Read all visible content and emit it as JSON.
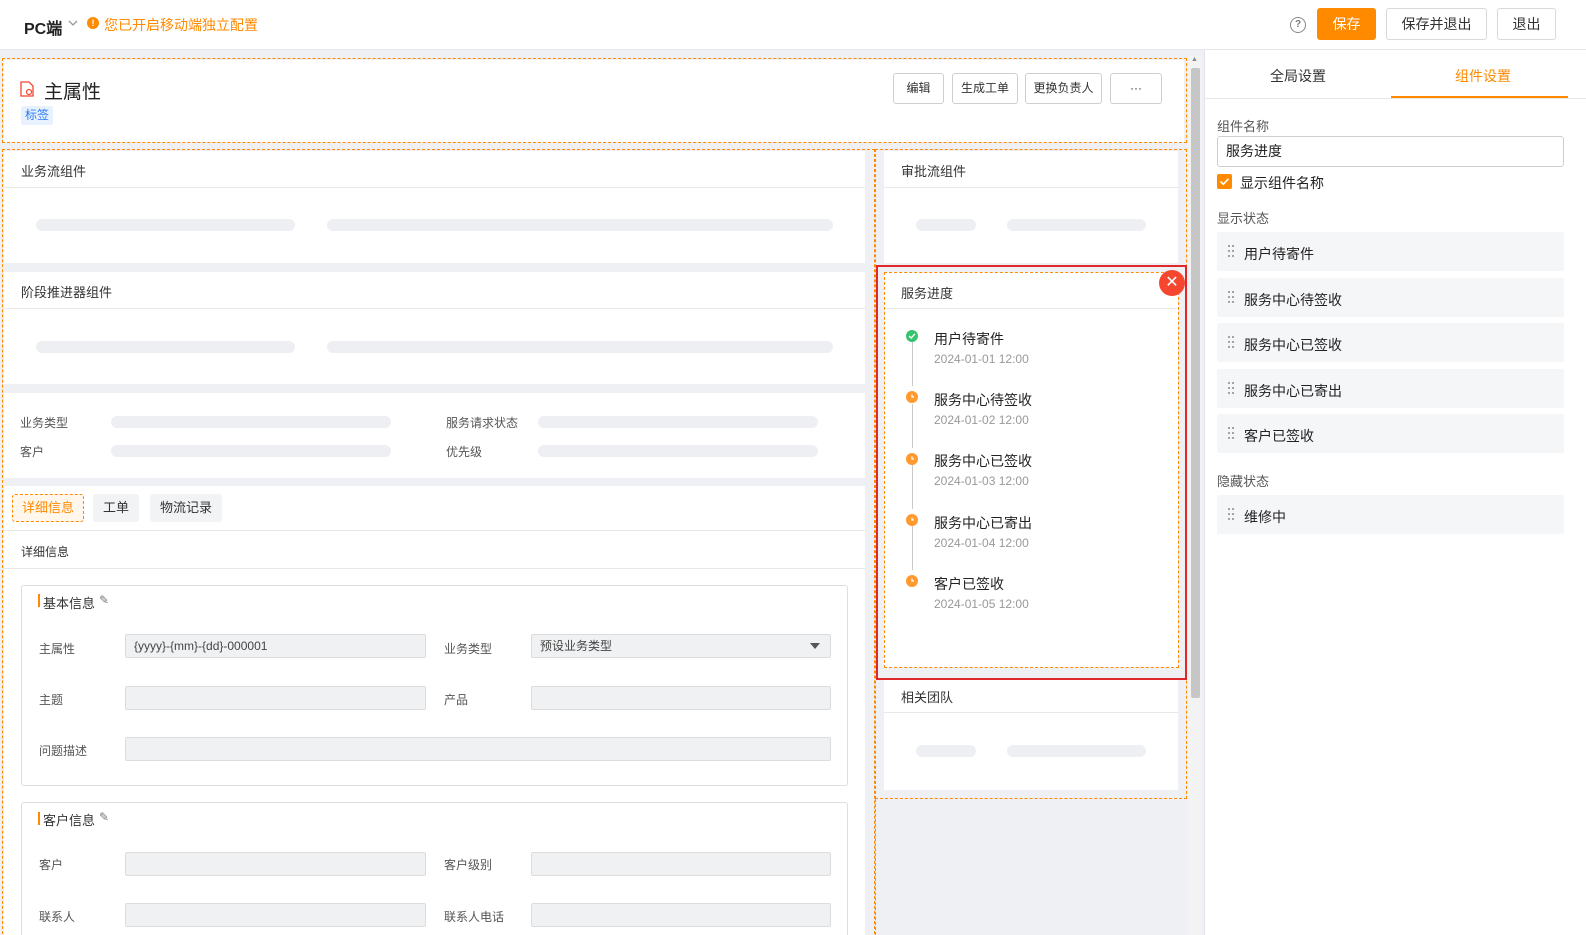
{
  "topbar": {
    "title": "PC端",
    "chevron": "chevron-down-icon",
    "warning_icon": "warning-circle-icon",
    "warning": "您已开启移动端独立配置",
    "help_icon": "help-circle-icon",
    "save": "保存",
    "save_exit": "保存并退出",
    "exit": "退出"
  },
  "colors": {
    "accent": "#ff8a00",
    "danger": "#f5462f",
    "success": "#36c36c",
    "tag_blue": "#2d7cf6"
  },
  "header": {
    "icon": "document-icon",
    "title": "主属性",
    "tag": "标签",
    "buttons": {
      "edit": "编辑",
      "gen_order": "生成工单",
      "change_owner": "更换负责人",
      "more": "···"
    }
  },
  "cards": {
    "bizflow": "业务流组件",
    "stage": "阶段推进器组件",
    "approval": "审批流组件",
    "service_progress": "服务进度",
    "team": "相关团队"
  },
  "summary": {
    "biz_type": "业务类型",
    "status": "服务请求状态",
    "customer": "客户",
    "priority": "优先级"
  },
  "tabs": [
    "详细信息",
    "工单",
    "物流记录"
  ],
  "detail": {
    "title": "详细信息",
    "basic": {
      "title": "基本信息",
      "main_attr": "主属性",
      "main_attr_value": "{yyyy}-{mm}-{dd}-000001",
      "biz_type": "业务类型",
      "biz_type_value": "预设业务类型",
      "subject": "主题",
      "product": "产品",
      "desc": "问题描述"
    },
    "customer": {
      "title": "客户信息",
      "customer": "客户",
      "level": "客户级别",
      "contact": "联系人",
      "phone": "联系人电话"
    }
  },
  "timeline": [
    {
      "title": "用户待寄件",
      "time": "2024-01-01 12:00",
      "state": "done"
    },
    {
      "title": "服务中心待签收",
      "time": "2024-01-02 12:00",
      "state": "pending"
    },
    {
      "title": "服务中心已签收",
      "time": "2024-01-03 12:00",
      "state": "pending"
    },
    {
      "title": "服务中心已寄出",
      "time": "2024-01-04 12:00",
      "state": "pending"
    },
    {
      "title": "客户已签收",
      "time": "2024-01-05 12:00",
      "state": "pending"
    }
  ],
  "right_panel": {
    "tab_global": "全局设置",
    "tab_component": "组件设置",
    "name_label": "组件名称",
    "name_value": "服务进度",
    "show_name": "显示组件名称",
    "shown_label": "显示状态",
    "shown": [
      "用户待寄件",
      "服务中心待签收",
      "服务中心已签收",
      "服务中心已寄出",
      "客户已签收"
    ],
    "hidden_label": "隐藏状态",
    "hidden": [
      "维修中"
    ]
  }
}
